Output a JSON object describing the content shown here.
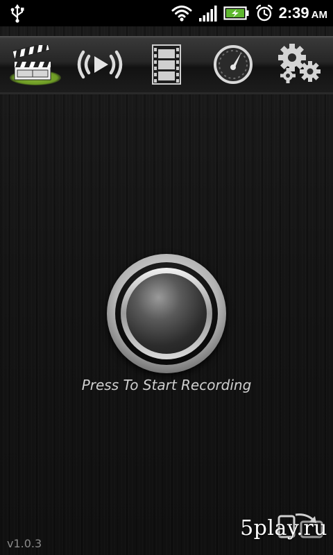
{
  "status_bar": {
    "icons": [
      "usb-icon",
      "wifi-icon",
      "signal-icon",
      "battery-charging-icon",
      "alarm-icon"
    ],
    "time": "2:39",
    "ampm": "AM"
  },
  "toolbar": {
    "tabs": [
      {
        "id": "record",
        "icon": "clapperboard-icon",
        "active": true
      },
      {
        "id": "stream",
        "icon": "broadcast-play-icon",
        "active": false
      },
      {
        "id": "videos",
        "icon": "film-strip-icon",
        "active": false
      },
      {
        "id": "quality",
        "icon": "gauge-icon",
        "active": false
      },
      {
        "id": "settings",
        "icon": "gears-icon",
        "active": false
      }
    ],
    "active_color": "#7aa52e"
  },
  "main": {
    "record_label": "Press To Start Recording"
  },
  "footer": {
    "version": "v1.0.3",
    "watermark": "5play.ru"
  }
}
